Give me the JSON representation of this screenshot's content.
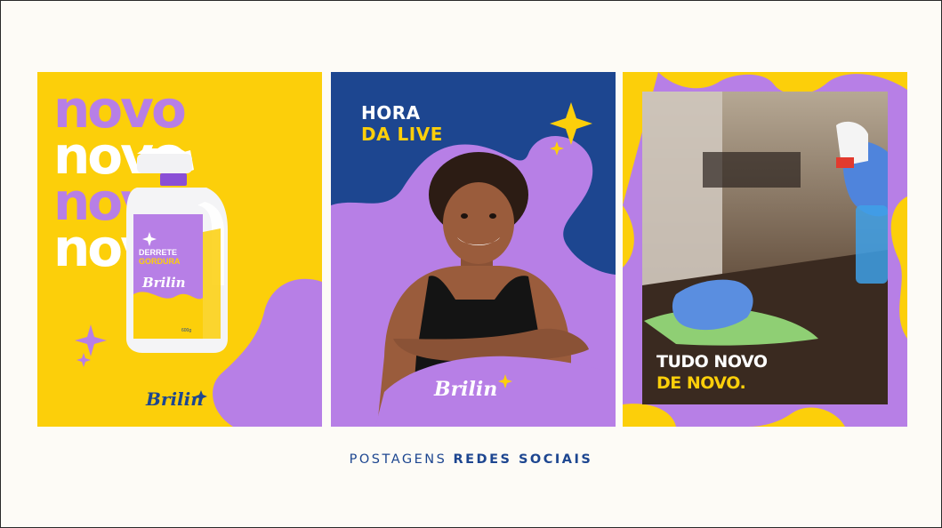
{
  "colors": {
    "yellow": "#fccf0a",
    "purple": "#b77fe6",
    "navy": "#1d4690",
    "white": "#ffffff"
  },
  "post1": {
    "repeat_word": "novo",
    "bottle": {
      "line1": "DERRETE",
      "line2": "GORDURA",
      "brand": "Brilin",
      "weight": "600g"
    },
    "logo": "Brilin"
  },
  "post2": {
    "title_line1": "HORA",
    "title_line2": "DA LIVE",
    "logo": "Brilin"
  },
  "post3": {
    "tagline_line1": "TUDO NOVO",
    "tagline_line2": "DE NOVO."
  },
  "footer": {
    "light": "POSTAGENS",
    "bold": "REDES SOCIAIS"
  }
}
